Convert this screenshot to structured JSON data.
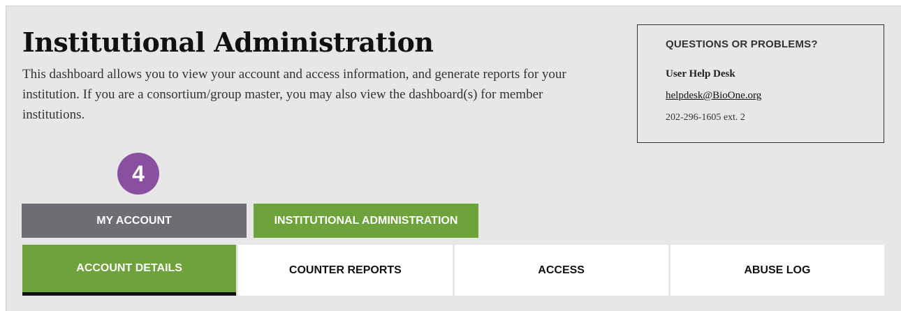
{
  "header": {
    "title": "Institutional Administration",
    "description": "This dashboard allows you to view your account and access information, and generate reports for your institution. If you are a consortium/group master, you may also view the dashboard(s) for member institutions."
  },
  "help_box": {
    "heading": "QUESTIONS OR PROBLEMS?",
    "desk_label": "User Help Desk",
    "email": "helpdesk@BioOne.org",
    "phone": "202-296-1605 ext. 2"
  },
  "step_badge": "4",
  "top_tabs": [
    {
      "label": "MY ACCOUNT",
      "color": "#6d6d73"
    },
    {
      "label": "INSTITUTIONAL ADMINISTRATION",
      "color": "#6ea23a"
    }
  ],
  "sub_tabs": [
    {
      "label": "ACCOUNT DETAILS",
      "active": true
    },
    {
      "label": "COUNTER REPORTS",
      "active": false
    },
    {
      "label": "ACCESS",
      "active": false
    },
    {
      "label": "ABUSE LOG",
      "active": false
    }
  ],
  "colors": {
    "accent_green": "#6ea23a",
    "tab_gray": "#6d6d73",
    "badge_purple": "#8a4fa0",
    "background": "#e7e7e7"
  }
}
